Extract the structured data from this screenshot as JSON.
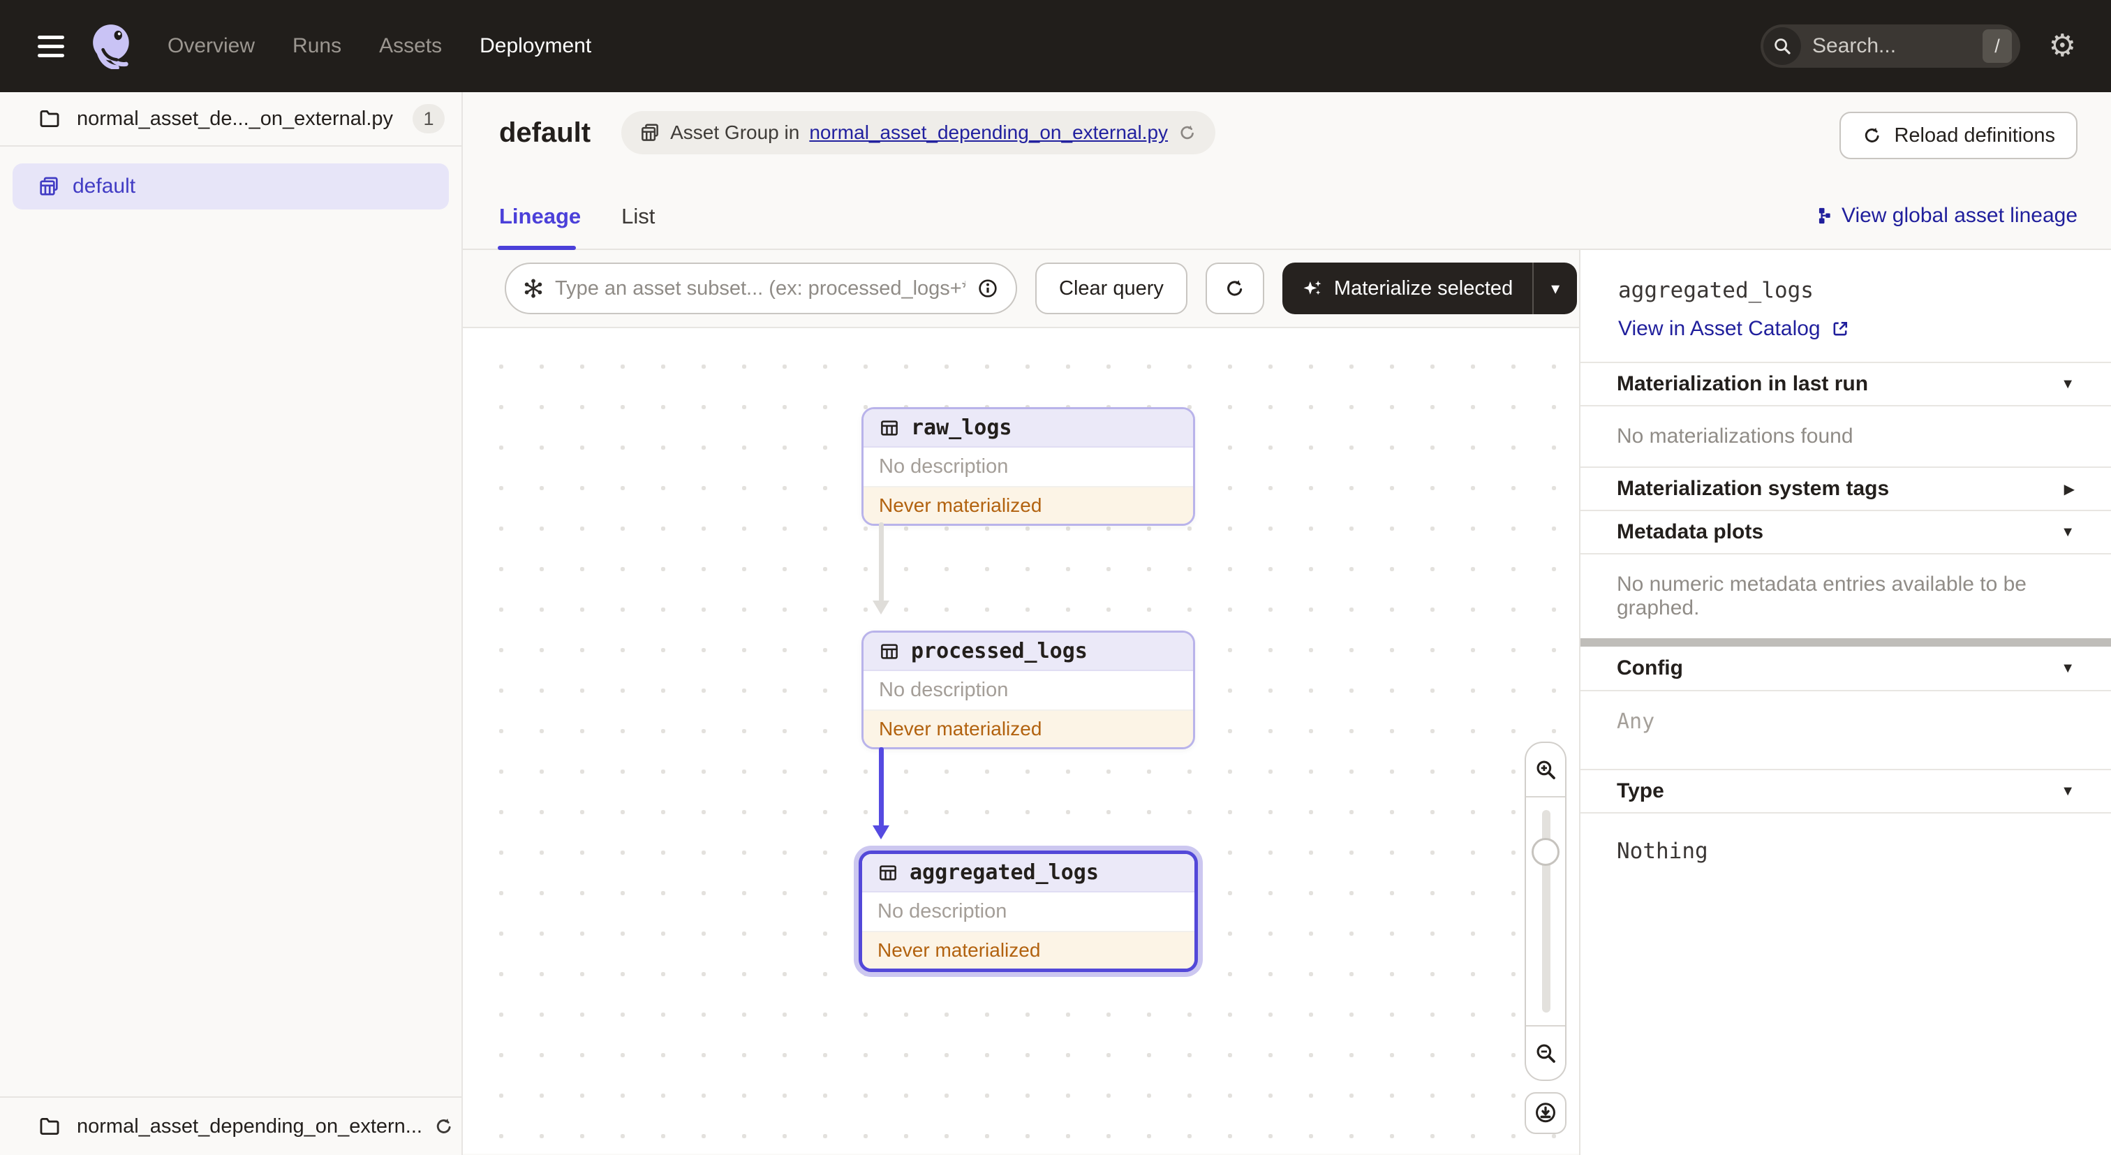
{
  "nav": {
    "items": [
      {
        "label": "Overview",
        "active": false
      },
      {
        "label": "Runs",
        "active": false
      },
      {
        "label": "Assets",
        "active": false
      },
      {
        "label": "Deployment",
        "active": true
      }
    ],
    "search": {
      "placeholder": "Search...",
      "shortcut": "/"
    }
  },
  "sidebar": {
    "code_location": {
      "label": "normal_asset_de..._on_external.py",
      "badge": "1"
    },
    "group_item": {
      "label": "default"
    },
    "footer": {
      "label": "normal_asset_depending_on_extern..."
    }
  },
  "header": {
    "title": "default",
    "asset_group_tag": {
      "prefix": "Asset Group in",
      "link": "normal_asset_depending_on_external.py"
    },
    "reload_button": "Reload definitions"
  },
  "tabs": {
    "lineage": "Lineage",
    "list": "List",
    "global_lineage_link": "View global asset lineage"
  },
  "toolbar": {
    "query_placeholder": "Type an asset subset... (ex: processed_logs+*)",
    "clear_button": "Clear query",
    "materialize_button": "Materialize selected"
  },
  "graph": {
    "nodes": [
      {
        "name": "raw_logs",
        "description": "No description",
        "status": "Never materialized"
      },
      {
        "name": "processed_logs",
        "description": "No description",
        "status": "Never materialized"
      },
      {
        "name": "aggregated_logs",
        "description": "No description",
        "status": "Never materialized"
      }
    ]
  },
  "panel": {
    "title": "aggregated_logs",
    "catalog_link": "View in Asset Catalog",
    "materialization_last_run": {
      "title": "Materialization in last run",
      "empty": "No materializations found"
    },
    "system_tags": {
      "title": "Materialization system tags"
    },
    "metadata_plots": {
      "title": "Metadata plots",
      "empty": "No numeric metadata entries available to be graphed."
    },
    "config": {
      "title": "Config",
      "value": "Any"
    },
    "type": {
      "title": "Type",
      "value": "Nothing"
    }
  },
  "colors": {
    "accent": "#4F43DD",
    "nav_bg": "#211E1B",
    "link_navy": "#201F9C",
    "status_text": "#B2620F",
    "status_bg": "#FCF4E6",
    "selected_border": "#5348D8"
  }
}
